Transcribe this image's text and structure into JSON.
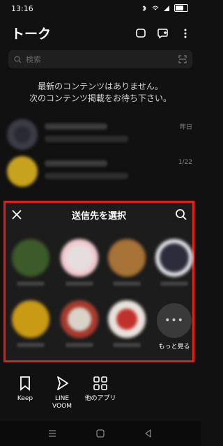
{
  "status": {
    "time": "13:16"
  },
  "header": {
    "title": "トーク"
  },
  "search": {
    "placeholder": "検索"
  },
  "empty_message": "最新のコンテンツはありません。\n次のコンテンツ掲載をお待ち下さい。",
  "chats": [
    {
      "date": "昨日",
      "avatar_color": "#2a2a33"
    },
    {
      "date": "1/22",
      "avatar_color": "#c7a21e"
    }
  ],
  "share_sheet": {
    "title": "送信先を選択",
    "friends": [
      {
        "avatar_color": "#3d5a2a"
      },
      {
        "avatar_color": "#e6dede"
      },
      {
        "avatar_color": "#a67236"
      },
      {
        "avatar_color": "#2c2c3a"
      },
      {
        "avatar_color": "#c99a13"
      },
      {
        "avatar_color": "#d9d2c9"
      },
      {
        "avatar_color": "#c0302c"
      }
    ],
    "more_label": "もっと見る",
    "more_glyph": "•••"
  },
  "apps": [
    {
      "label": "Keep",
      "icon": "bookmark-icon"
    },
    {
      "label": "LINE\nVOOM",
      "icon": "play-icon"
    },
    {
      "label": "他のアプリ",
      "icon": "grid-icon"
    }
  ],
  "colors": {
    "highlight": "#e0201d",
    "background": "#111111"
  }
}
